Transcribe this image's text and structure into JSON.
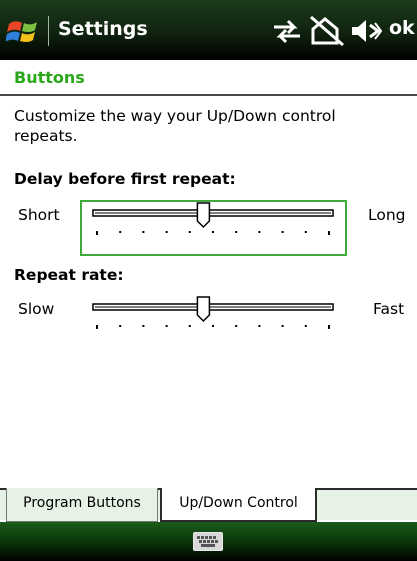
{
  "titlebar": {
    "app_title": "Settings",
    "ok_label": "ok",
    "icons": [
      "windows-start-logo",
      "connectivity-icon",
      "signal-off-icon",
      "volume-off-icon"
    ]
  },
  "header": {
    "title": "Buttons"
  },
  "content": {
    "description": "Customize the way your Up/Down control repeats.",
    "delay": {
      "label": "Delay before first repeat:",
      "min_label": "Short",
      "max_label": "Long",
      "position": 0.46,
      "ticks": 11
    },
    "rate": {
      "label": "Repeat rate:",
      "min_label": "Slow",
      "max_label": "Fast",
      "position": 0.46,
      "ticks": 11
    }
  },
  "tabs": [
    {
      "label": "Program Buttons",
      "active": false
    },
    {
      "label": "Up/Down Control",
      "active": true
    }
  ],
  "menubar": {
    "icons": [
      "keyboard-icon"
    ]
  },
  "colors": {
    "accent": "#2aa81a",
    "focus_border": "#3faa3a",
    "tab_background": "#e6f2e6",
    "titlebar": "#0f230f"
  }
}
